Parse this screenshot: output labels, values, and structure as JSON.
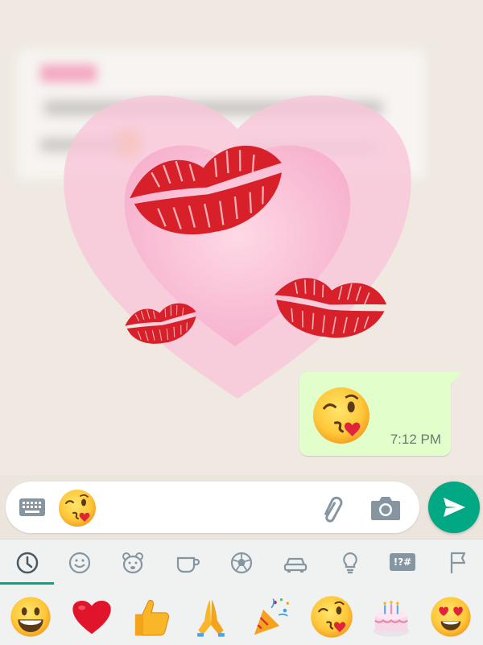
{
  "chat": {
    "message": {
      "emoji": "face-blowing-kiss",
      "time": "7:12 PM"
    }
  },
  "composer": {
    "current_emoji": "face-blowing-kiss",
    "icons": [
      "keyboard-icon",
      "attach-icon",
      "camera-icon"
    ],
    "send_icon": "send-icon"
  },
  "emoji_keyboard": {
    "categories": [
      "recent",
      "smileys",
      "animals",
      "food",
      "activity",
      "travel",
      "objects",
      "symbols",
      "flags"
    ],
    "symbols_label": "!?#",
    "active_category": "recent",
    "emojis": [
      "grinning-face",
      "red-heart",
      "thumbs-up",
      "folded-hands",
      "party-popper",
      "face-blowing-kiss",
      "birthday-cake",
      "heart-eyes-face"
    ]
  },
  "colors": {
    "accent": "#00a884",
    "outgoing_bubble": "#e2fecb",
    "kiss_red": "#d8202b",
    "heart_pink": "#f7b8d2"
  }
}
